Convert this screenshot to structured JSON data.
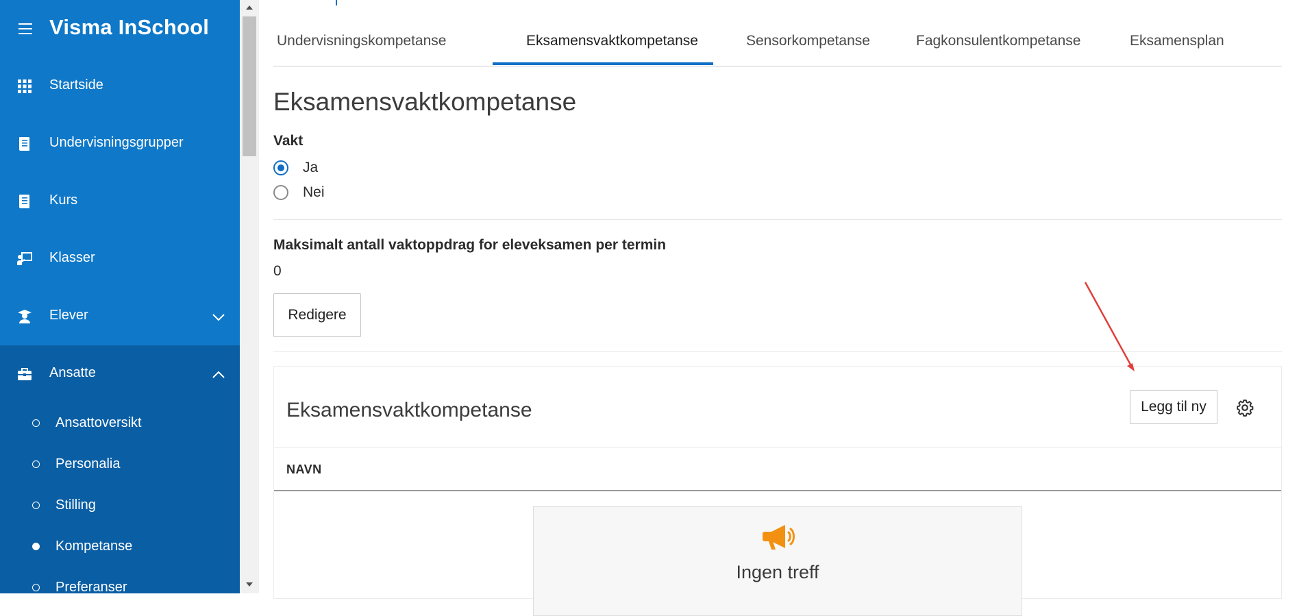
{
  "sidebar": {
    "app_title": "Visma InSchool",
    "items": [
      {
        "label": "Startside",
        "icon": "grid-icon"
      },
      {
        "label": "Undervisningsgrupper",
        "icon": "book-icon"
      },
      {
        "label": "Kurs",
        "icon": "book-icon"
      },
      {
        "label": "Klasser",
        "icon": "presentation-icon"
      },
      {
        "label": "Elever",
        "icon": "student-icon",
        "expandable": true
      },
      {
        "label": "Ansatte",
        "icon": "briefcase-icon",
        "expanded": true
      }
    ],
    "subitems": [
      {
        "label": "Ansattoversikt",
        "active": false
      },
      {
        "label": "Personalia",
        "active": false
      },
      {
        "label": "Stilling",
        "active": false
      },
      {
        "label": "Kompetanse",
        "active": true
      },
      {
        "label": "Preferanser",
        "active": false
      }
    ],
    "colors": {
      "bg": "#0f78c8",
      "sub_bg": "#0a5ea4"
    }
  },
  "tabs": [
    {
      "label": "Undervisningskompetanse",
      "active": false
    },
    {
      "label": "Eksamensvaktkompetanse",
      "active": true
    },
    {
      "label": "Sensorkompetanse",
      "active": false
    },
    {
      "label": "Fagkonsulentkompetanse",
      "active": false
    },
    {
      "label": "Eksamensplan",
      "active": false
    }
  ],
  "page": {
    "title": "Eksamensvaktkompetanse",
    "vakt_label": "Vakt",
    "radio_options": [
      {
        "label": "Ja",
        "checked": true
      },
      {
        "label": "Nei",
        "checked": false
      }
    ],
    "max_label": "Maksimalt antall vaktoppdrag for eleveksamen per termin",
    "max_value": "0",
    "edit_button": "Redigere"
  },
  "panel": {
    "title": "Eksamensvaktkompetanse",
    "add_button": "Legg til ny",
    "column_name": "NAVN",
    "empty_text": "Ingen treff"
  },
  "accent": "#0f6fc6",
  "annotation_arrow_color": "#e0403a"
}
